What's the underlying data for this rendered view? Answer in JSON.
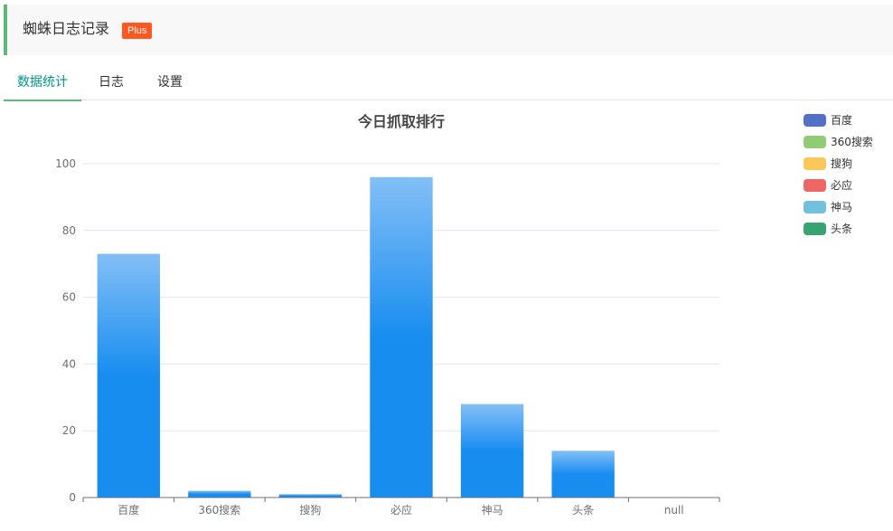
{
  "header": {
    "title": "蜘蛛日志记录",
    "badge": "Plus",
    "accent_color": "#5fb878",
    "badge_color": "#ff5722"
  },
  "tabs": [
    {
      "label": "数据统计",
      "active": true
    },
    {
      "label": "日志",
      "active": false
    },
    {
      "label": "设置",
      "active": false
    }
  ],
  "legend": [
    {
      "label": "百度",
      "color": "#5470c6"
    },
    {
      "label": "360搜索",
      "color": "#91cc75"
    },
    {
      "label": "搜狗",
      "color": "#fac858"
    },
    {
      "label": "必应",
      "color": "#ee6666"
    },
    {
      "label": "神马",
      "color": "#73c0de"
    },
    {
      "label": "头条",
      "color": "#3ba272"
    }
  ],
  "chart_data": {
    "type": "bar",
    "title": "今日抓取排行",
    "categories": [
      "百度",
      "360搜索",
      "搜狗",
      "必应",
      "神马",
      "头条",
      "null"
    ],
    "values": [
      73,
      2,
      1,
      96,
      28,
      14,
      0
    ],
    "ylim": [
      0,
      100
    ],
    "yticks": [
      0,
      20,
      40,
      60,
      80,
      100
    ],
    "xlabel": "",
    "ylabel": "",
    "grid": true,
    "legend_position": "top-right",
    "bar_gradient": [
      "#83bff6",
      "#188df0"
    ]
  }
}
